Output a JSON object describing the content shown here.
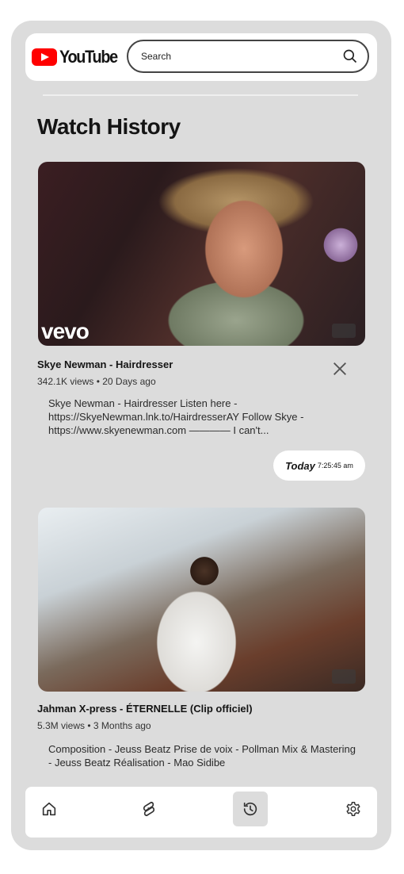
{
  "app": {
    "brand": "YouTube",
    "brand_color": "#ff0000"
  },
  "search": {
    "placeholder": "Search"
  },
  "page": {
    "title": "Watch History"
  },
  "videos": [
    {
      "title": "Skye Newman - Hairdresser",
      "meta": "342.1K views • 20 Days ago",
      "description": "Skye Newman - Hairdresser Listen here - https://SkyeNewman.lnk.to/HairdresserAY Follow Skye - https://www.skyenewman.com ———— I can't...",
      "overlay": "vevo",
      "watched_label": "Today",
      "watched_time": "7:25:45 am"
    },
    {
      "title": "Jahman X-press - ÉTERNELLE (Clip officiel)",
      "meta": "5.3M views • 3 Months ago",
      "description": "Composition - Jeuss Beatz Prise de voix - Pollman Mix & Mastering - Jeuss Beatz Réalisation - Mao Sidibe"
    }
  ],
  "nav": {
    "items": [
      {
        "name": "home",
        "icon": "home-icon",
        "active": false
      },
      {
        "name": "shorts",
        "icon": "shorts-icon",
        "active": false
      },
      {
        "name": "history",
        "icon": "history-icon",
        "active": true
      },
      {
        "name": "settings",
        "icon": "gear-icon",
        "active": false
      }
    ]
  }
}
